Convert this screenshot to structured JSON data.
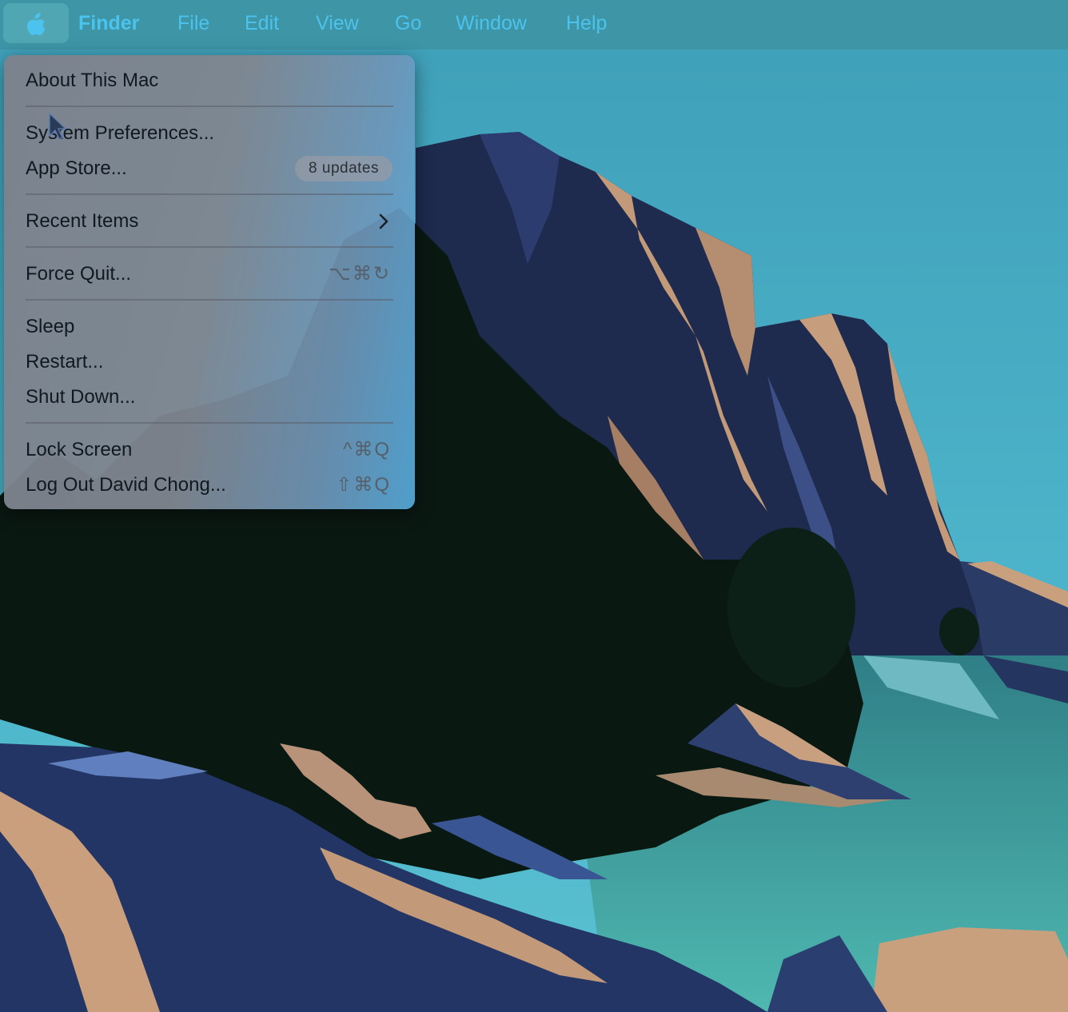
{
  "menubar": {
    "apple_icon": "apple-logo-icon",
    "items": [
      {
        "label": "Finder"
      },
      {
        "label": "File"
      },
      {
        "label": "Edit"
      },
      {
        "label": "View"
      },
      {
        "label": "Go"
      },
      {
        "label": "Window"
      },
      {
        "label": "Help"
      }
    ]
  },
  "apple_menu": {
    "about": {
      "label": "About This Mac"
    },
    "system_preferences": {
      "label": "System Preferences..."
    },
    "app_store": {
      "label": "App Store...",
      "badge": "8 updates"
    },
    "recent_items": {
      "label": "Recent Items",
      "icon": "chevron-right-icon"
    },
    "force_quit": {
      "label": "Force Quit...",
      "shortcut": "⌥⌘↻"
    },
    "sleep": {
      "label": "Sleep"
    },
    "restart": {
      "label": "Restart..."
    },
    "shut_down": {
      "label": "Shut Down..."
    },
    "lock_screen": {
      "label": "Lock Screen",
      "shortcut": "^⌘Q"
    },
    "log_out": {
      "label": "Log Out David Chong...",
      "shortcut": "⇧⌘Q"
    }
  },
  "colors": {
    "menubar_text": "#4cc3ee",
    "sky": "#4fb3c8",
    "cliff_dark": "#1c2a4a",
    "cliff_highlight": "#c49a78",
    "forest": "#0b1a12",
    "lake": "#3e9c9a"
  },
  "wallpaper": {
    "scene": "cliffs-lake-forest"
  },
  "cursor": {
    "icon": "arrow-pointer-icon"
  }
}
